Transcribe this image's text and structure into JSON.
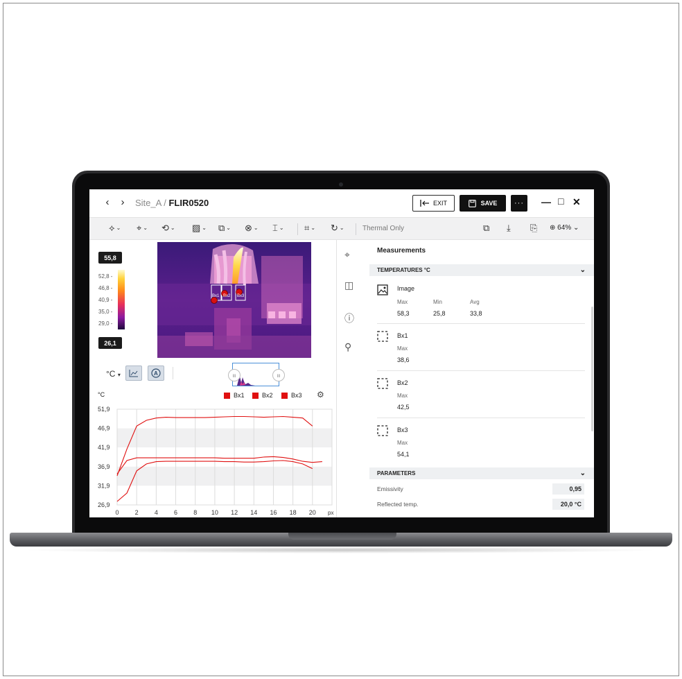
{
  "window": {
    "breadcrumb_parent": "Site_A",
    "breadcrumb_sep": "/",
    "breadcrumb_current": "FLIR0520",
    "exit_label": "EXIT",
    "save_label": "SAVE",
    "more_label": "···"
  },
  "toolbar": {
    "mode_label": "Thermal Only",
    "zoom_label": "64%"
  },
  "scale": {
    "max": "55,8",
    "min": "26,1",
    "ticks": [
      "52,8 -",
      "46,8 -",
      "40,9 -",
      "35,0 -",
      "29,0 -"
    ]
  },
  "thermal_image": {
    "box_labels": [
      "Bx1",
      "Bx2",
      "Bx3"
    ]
  },
  "view_controls": {
    "unit": "°C",
    "unit_chevron": "▾"
  },
  "chart_data": {
    "type": "line",
    "ylabel": "°C",
    "y_ticks": [
      "51,9",
      "46,9",
      "41,9",
      "36,9",
      "31,9",
      "26,9"
    ],
    "x_ticks": [
      "0",
      "2",
      "4",
      "6",
      "8",
      "10",
      "12",
      "14",
      "16",
      "18",
      "20"
    ],
    "x_unit": "px",
    "ylim": [
      26.9,
      51.9
    ],
    "x": [
      0,
      1,
      2,
      3,
      4,
      5,
      6,
      7,
      8,
      9,
      10,
      11,
      12,
      13,
      14,
      15,
      16,
      17,
      18,
      19,
      20,
      21
    ],
    "series": [
      {
        "name": "Bx1",
        "values": [
          35.0,
          38.5,
          39.2,
          39.2,
          39.2,
          39.2,
          39.2,
          39.2,
          39.2,
          39.2,
          39.2,
          39.1,
          39.1,
          39.1,
          39.1,
          39.4,
          39.5,
          39.3,
          38.9,
          38.3,
          38.0,
          38.2
        ]
      },
      {
        "name": "Bx2",
        "values": [
          27.8,
          30.0,
          35.8,
          37.6,
          38.2,
          38.3,
          38.3,
          38.3,
          38.3,
          38.3,
          38.3,
          38.2,
          38.2,
          38.1,
          38.1,
          38.2,
          38.4,
          38.5,
          38.2,
          37.6,
          36.4,
          null
        ]
      },
      {
        "name": "Bx3",
        "values": [
          34.5,
          41.5,
          47.5,
          49.0,
          49.6,
          49.8,
          49.7,
          49.7,
          49.7,
          49.7,
          49.8,
          49.9,
          50.0,
          50.0,
          49.9,
          49.8,
          49.9,
          50.0,
          49.8,
          49.6,
          47.5,
          null
        ]
      }
    ],
    "colors": {
      "Bx1": "#e01010",
      "Bx2": "#e01010",
      "Bx3": "#e01010"
    },
    "grid": true,
    "legend": "top-right"
  },
  "right_panel": {
    "title": "Measurements",
    "temperatures_header": "TEMPERATURES °C",
    "image": {
      "name": "Image",
      "max_label": "Max",
      "min_label": "Min",
      "avg_label": "Avg",
      "max": "58,3",
      "min": "25,8",
      "avg": "33,8"
    },
    "boxes": [
      {
        "name": "Bx1",
        "max_label": "Max",
        "max": "38,6"
      },
      {
        "name": "Bx2",
        "max_label": "Max",
        "max": "42,5"
      },
      {
        "name": "Bx3",
        "max_label": "Max",
        "max": "54,1"
      }
    ],
    "parameters_header": "PARAMETERS",
    "params": [
      {
        "label": "Emissivity",
        "value": "0,95"
      },
      {
        "label": "Reflected temp.",
        "value": "20,0 °C"
      }
    ]
  },
  "colors": {
    "accent": "#4a8fd8",
    "dark": "#111111",
    "series_red": "#e01010",
    "panel_gray": "#eef0f2"
  }
}
